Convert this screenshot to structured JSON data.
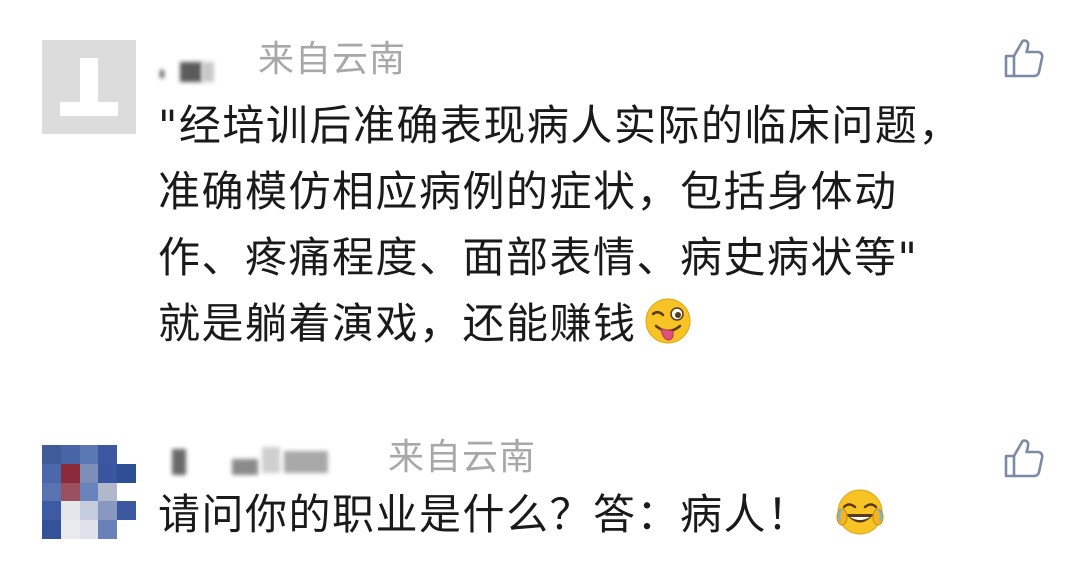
{
  "comments": [
    {
      "location": "来自云南",
      "lines": [
        "\"经培训后准确表现病人实际的临床问题，",
        "准确模仿相应病例的症状，包括身体动",
        "作、疼痛程度、面部表情、病史病状等\"",
        "就是躺着演戏，还能赚钱"
      ],
      "emoji": "winking-tongue-face-icon",
      "like_icon": "thumbs-up-icon"
    },
    {
      "location": "来自云南",
      "lines": [
        "请问你的职业是什么？答：病人！"
      ],
      "emoji": "rolling-laughing-face-icon",
      "like_icon": "thumbs-up-icon"
    }
  ],
  "colors": {
    "text": "#1a1a1a",
    "secondary_text": "#a8a8a8",
    "like_icon": "#7a8aa8",
    "emoji_yellow": "#f7c325"
  }
}
